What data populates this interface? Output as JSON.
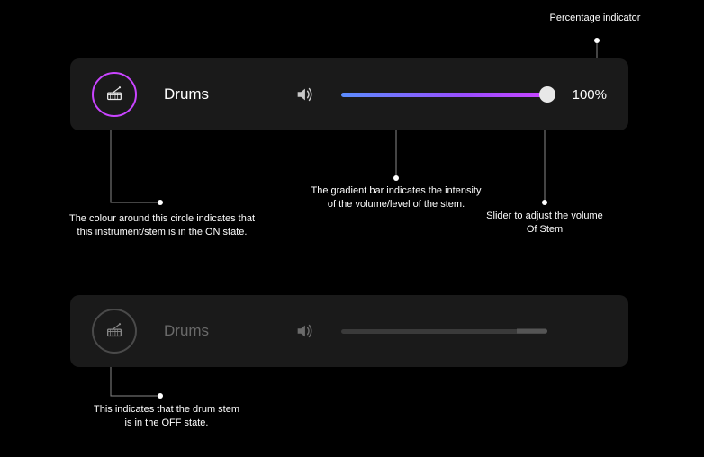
{
  "annotations": {
    "percentage_indicator": "Percentage indicator",
    "on_state": "The colour around this circle indicates that\nthis instrument/stem is in the ON state.",
    "gradient_bar": "The gradient bar indicates the intensity\nof the volume/level of the stem.",
    "slider_adjust": "Slider to adjust the volume\nOf Stem",
    "off_state": "This indicates that the drum stem\nis in the OFF state."
  },
  "stem_on": {
    "label": "Drums",
    "percent": "100%",
    "value": 100
  },
  "stem_off": {
    "label": "Drums",
    "value": 85
  },
  "colors": {
    "accent": "#c944ff",
    "gradient_start": "#5b8dff",
    "gradient_end": "#c944ff",
    "card_bg": "#1a1a1a",
    "off_border": "#4a4a4a"
  }
}
